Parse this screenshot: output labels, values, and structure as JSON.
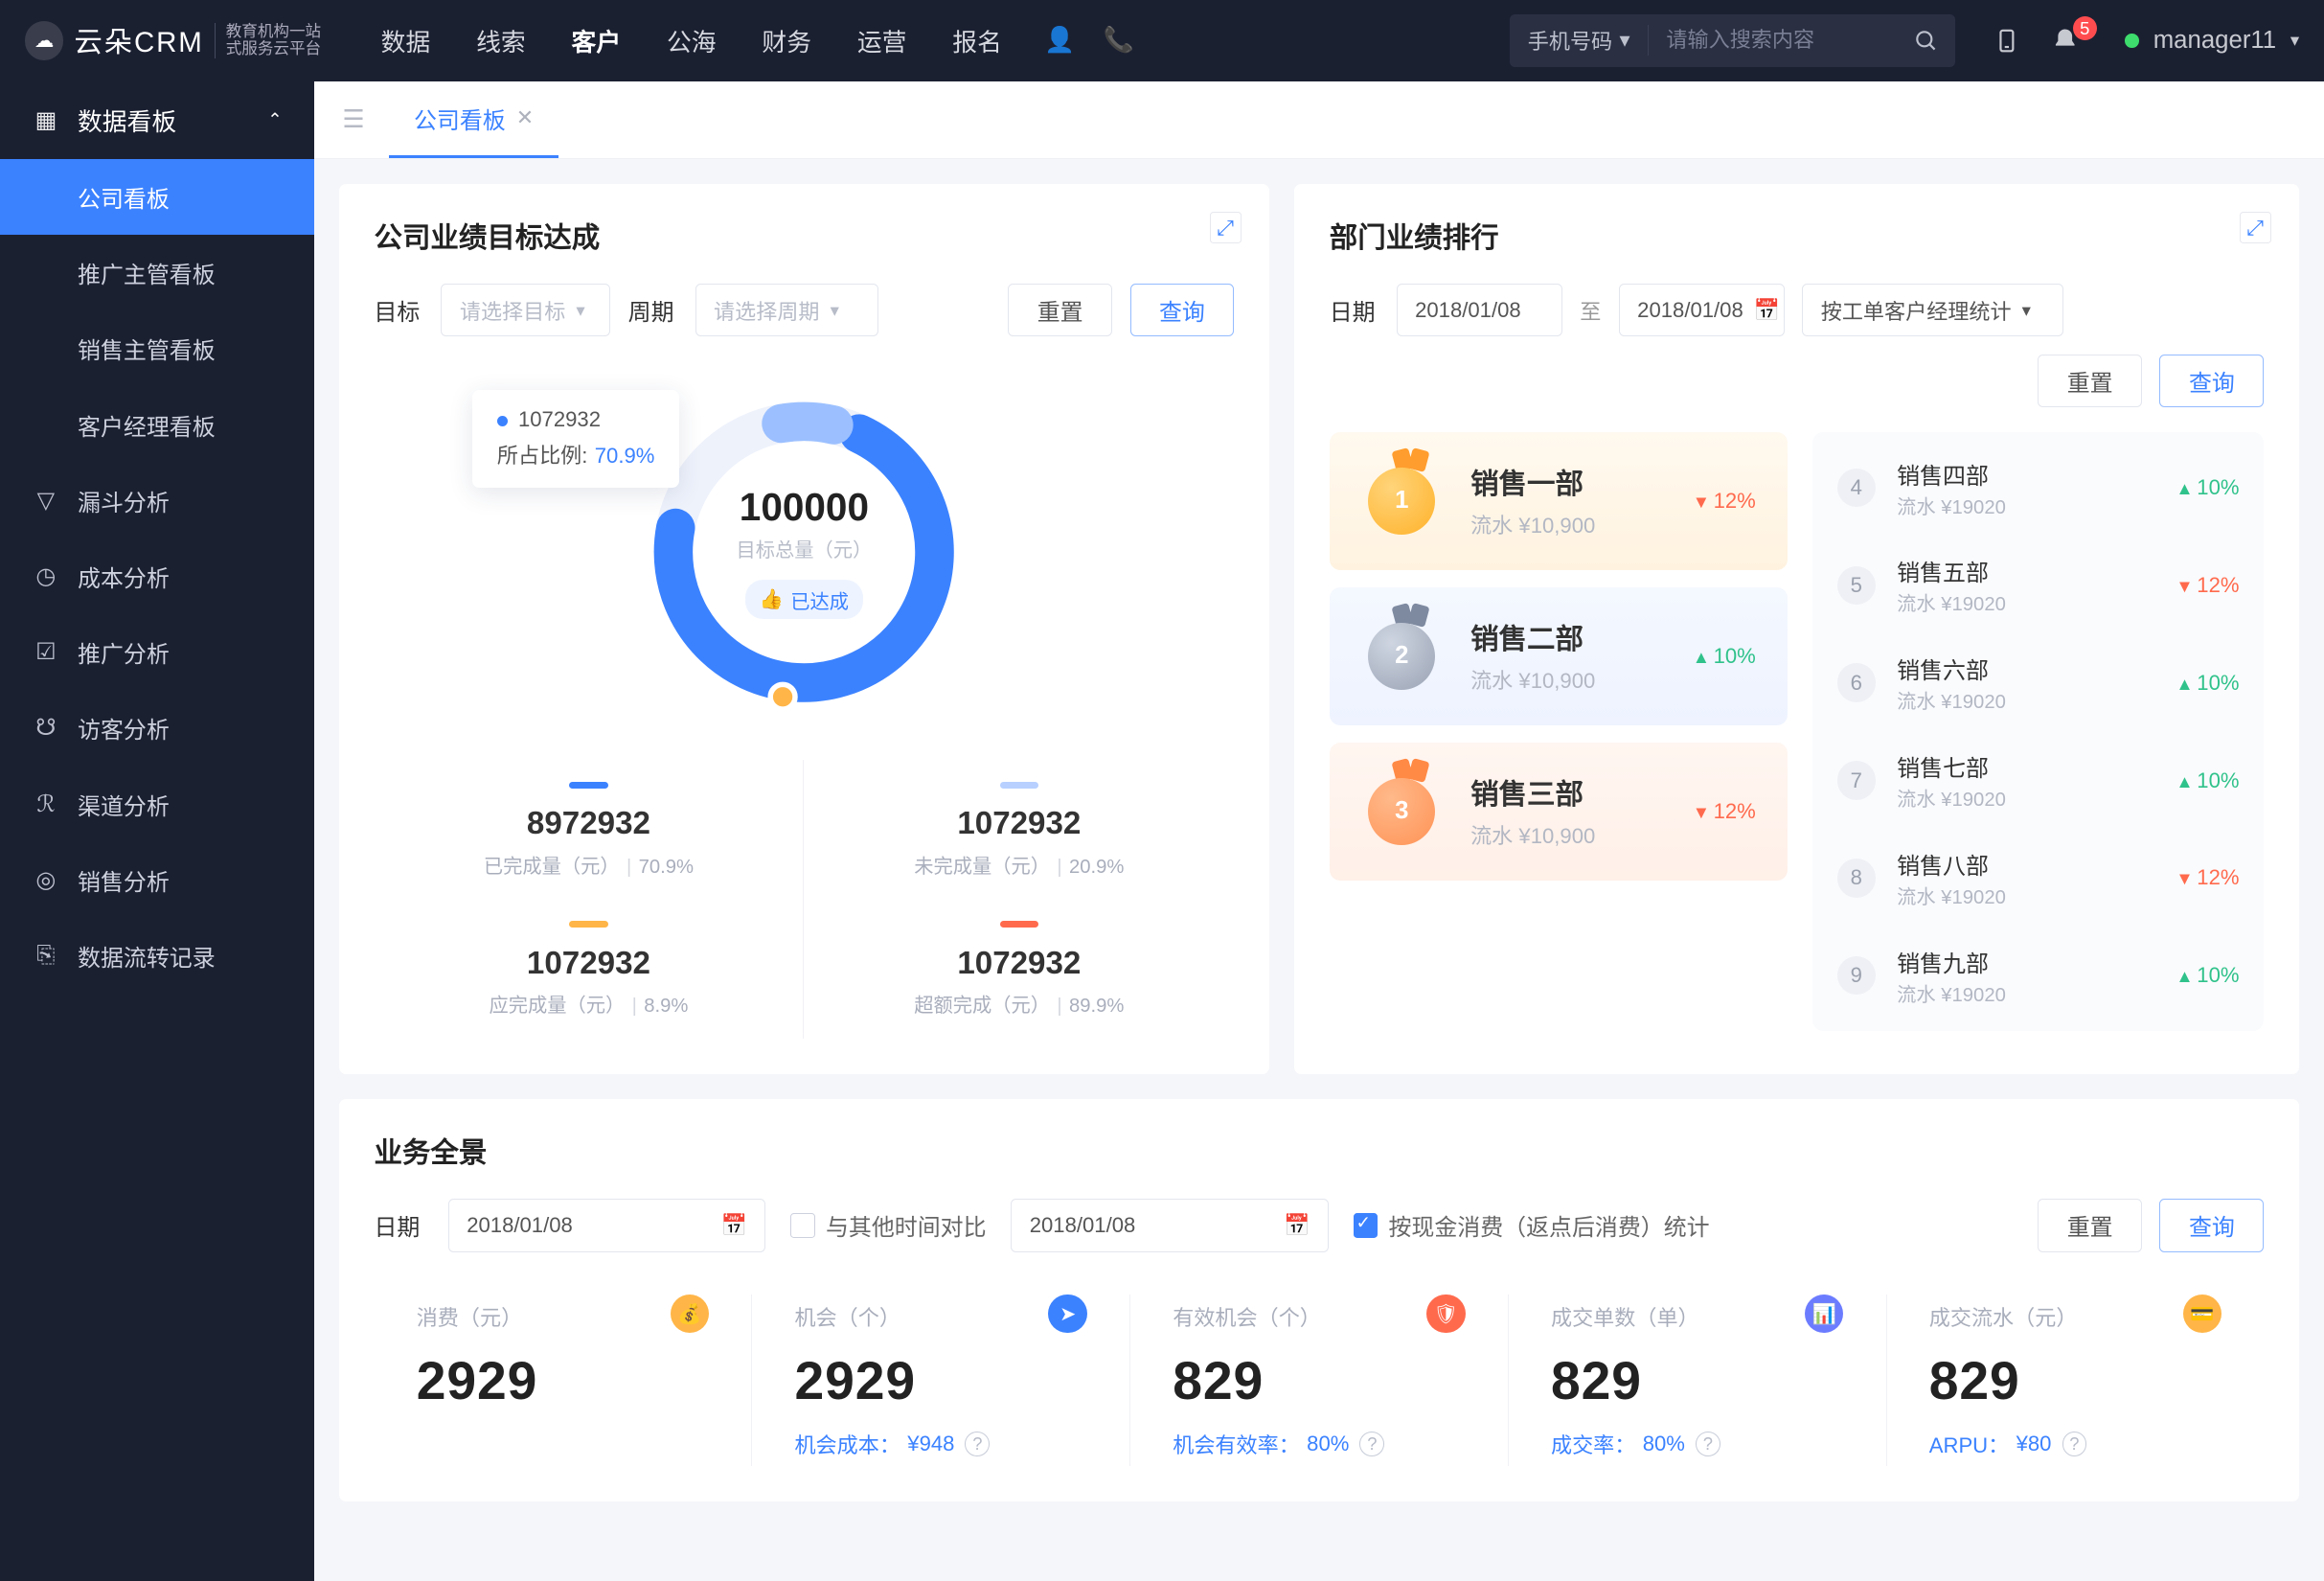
{
  "colors": {
    "accent": "#3b82ff",
    "danger": "#ff6a4d",
    "success": "#30c28b",
    "warn": "#ffb547"
  },
  "topbar": {
    "logo": "云朵CRM",
    "logoSub1": "教育机构一站",
    "logoSub2": "式服务云平台",
    "nav": [
      "数据",
      "线索",
      "客户",
      "公海",
      "财务",
      "运营",
      "报名"
    ],
    "activeNav": "客户",
    "searchType": "手机号码",
    "searchPlaceholder": "请输入搜索内容",
    "notifCount": "5",
    "user": "manager11"
  },
  "sidebar": {
    "group": "数据看板",
    "items": [
      "公司看板",
      "推广主管看板",
      "销售主管看板",
      "客户经理看板"
    ],
    "active": "公司看板",
    "links": [
      {
        "icon": "funnel-icon",
        "label": "漏斗分析"
      },
      {
        "icon": "clock-icon",
        "label": "成本分析"
      },
      {
        "icon": "chart-icon",
        "label": "推广分析"
      },
      {
        "icon": "visitor-icon",
        "label": "访客分析"
      },
      {
        "icon": "channel-icon",
        "label": "渠道分析"
      },
      {
        "icon": "sales-icon",
        "label": "销售分析"
      },
      {
        "icon": "flow-icon",
        "label": "数据流转记录"
      }
    ]
  },
  "tabs": {
    "current": "公司看板"
  },
  "target": {
    "title": "公司业绩目标达成",
    "lblTarget": "目标",
    "phTarget": "请选择目标",
    "lblPeriod": "周期",
    "phPeriod": "请选择周期",
    "reset": "重置",
    "query": "查询",
    "tooltip": {
      "value": "1072932",
      "label": "所占比例:",
      "pct": "70.9%"
    },
    "center": {
      "total": "100000",
      "totalLabel": "目标总量（元）",
      "status": "已达成"
    },
    "metrics": [
      {
        "value": "8972932",
        "label": "已完成量（元）",
        "pct": "70.9%"
      },
      {
        "value": "1072932",
        "label": "未完成量（元）",
        "pct": "20.9%"
      },
      {
        "value": "1072932",
        "label": "应完成量（元）",
        "pct": "8.9%"
      },
      {
        "value": "1072932",
        "label": "超额完成（元）",
        "pct": "89.9%"
      }
    ]
  },
  "rank": {
    "title": "部门业绩排行",
    "lblDate": "日期",
    "d1": "2018/01/08",
    "sep": "至",
    "d2": "2018/01/08",
    "by": "按工单客户经理统计",
    "reset": "重置",
    "query": "查询",
    "top": [
      {
        "name": "销售一部",
        "sub": "流水 ¥10,900",
        "dir": "down",
        "pct": "12%"
      },
      {
        "name": "销售二部",
        "sub": "流水 ¥10,900",
        "dir": "up",
        "pct": "10%"
      },
      {
        "name": "销售三部",
        "sub": "流水 ¥10,900",
        "dir": "down",
        "pct": "12%"
      }
    ],
    "rest": [
      {
        "rk": "4",
        "name": "销售四部",
        "sub": "流水 ¥19020",
        "dir": "up",
        "pct": "10%"
      },
      {
        "rk": "5",
        "name": "销售五部",
        "sub": "流水 ¥19020",
        "dir": "down",
        "pct": "12%"
      },
      {
        "rk": "6",
        "name": "销售六部",
        "sub": "流水 ¥19020",
        "dir": "up",
        "pct": "10%"
      },
      {
        "rk": "7",
        "name": "销售七部",
        "sub": "流水 ¥19020",
        "dir": "up",
        "pct": "10%"
      },
      {
        "rk": "8",
        "name": "销售八部",
        "sub": "流水 ¥19020",
        "dir": "down",
        "pct": "12%"
      },
      {
        "rk": "9",
        "name": "销售九部",
        "sub": "流水 ¥19020",
        "dir": "up",
        "pct": "10%"
      }
    ]
  },
  "overview": {
    "title": "业务全景",
    "lblDate": "日期",
    "d1": "2018/01/08",
    "compare": "与其他时间对比",
    "d2": "2018/01/08",
    "chk2": "按现金消费（返点后消费）统计",
    "reset": "重置",
    "query": "查询",
    "kpis": [
      {
        "tl": "消费（元）",
        "big": "2929",
        "ft": ""
      },
      {
        "tl": "机会（个）",
        "big": "2929",
        "ftL": "机会成本：",
        "ftV": "¥948"
      },
      {
        "tl": "有效机会（个）",
        "big": "829",
        "ftL": "机会有效率：",
        "ftV": "80%"
      },
      {
        "tl": "成交单数（单）",
        "big": "829",
        "ftL": "成交率：",
        "ftV": "80%"
      },
      {
        "tl": "成交流水（元）",
        "big": "829",
        "ftL": "ARPU：",
        "ftV": "¥80"
      }
    ]
  },
  "chart_data": {
    "type": "pie",
    "title": "公司业绩目标达成",
    "total": 100000,
    "total_label": "目标总量（元）",
    "series": [
      {
        "name": "已完成量（元）",
        "value": 8972932,
        "pct": 70.9
      },
      {
        "name": "未完成量（元）",
        "value": 1072932,
        "pct": 20.9
      },
      {
        "name": "应完成量（元）",
        "value": 1072932,
        "pct": 8.9
      },
      {
        "name": "超额完成（元）",
        "value": 1072932,
        "pct": 89.9
      }
    ],
    "highlight": {
      "value": 1072932,
      "pct": 70.9
    }
  }
}
